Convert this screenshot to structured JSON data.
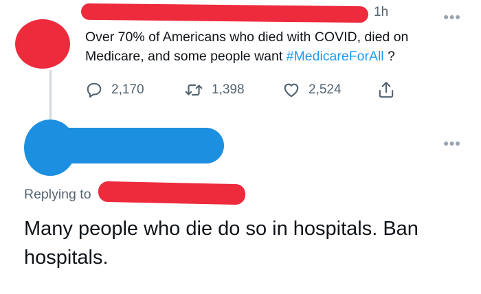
{
  "tweet": {
    "timestamp": "1h",
    "more_icon": "more-horizontal-icon",
    "text_before": "Over 70% of Americans who died with COVID, died on Medicare, and some people want ",
    "hashtag": "#MedicareForAll",
    "text_after": " ?",
    "actions": {
      "reply": {
        "icon": "reply-icon",
        "count": "2,170"
      },
      "retweet": {
        "icon": "retweet-icon",
        "count": "1,398"
      },
      "like": {
        "icon": "heart-icon",
        "count": "2,524"
      },
      "share": {
        "icon": "share-icon"
      }
    },
    "colors": {
      "hashtag": "#1d9bf0",
      "meta": "#536471"
    }
  },
  "reply": {
    "more_icon": "more-horizontal-icon",
    "replying_to_label": "Replying to",
    "text": "Many people who die do so in hospitals. Ban hospitals."
  },
  "redactions": {
    "colors": {
      "red": "#ee2a3d",
      "blue": "#1d8fe0"
    }
  }
}
